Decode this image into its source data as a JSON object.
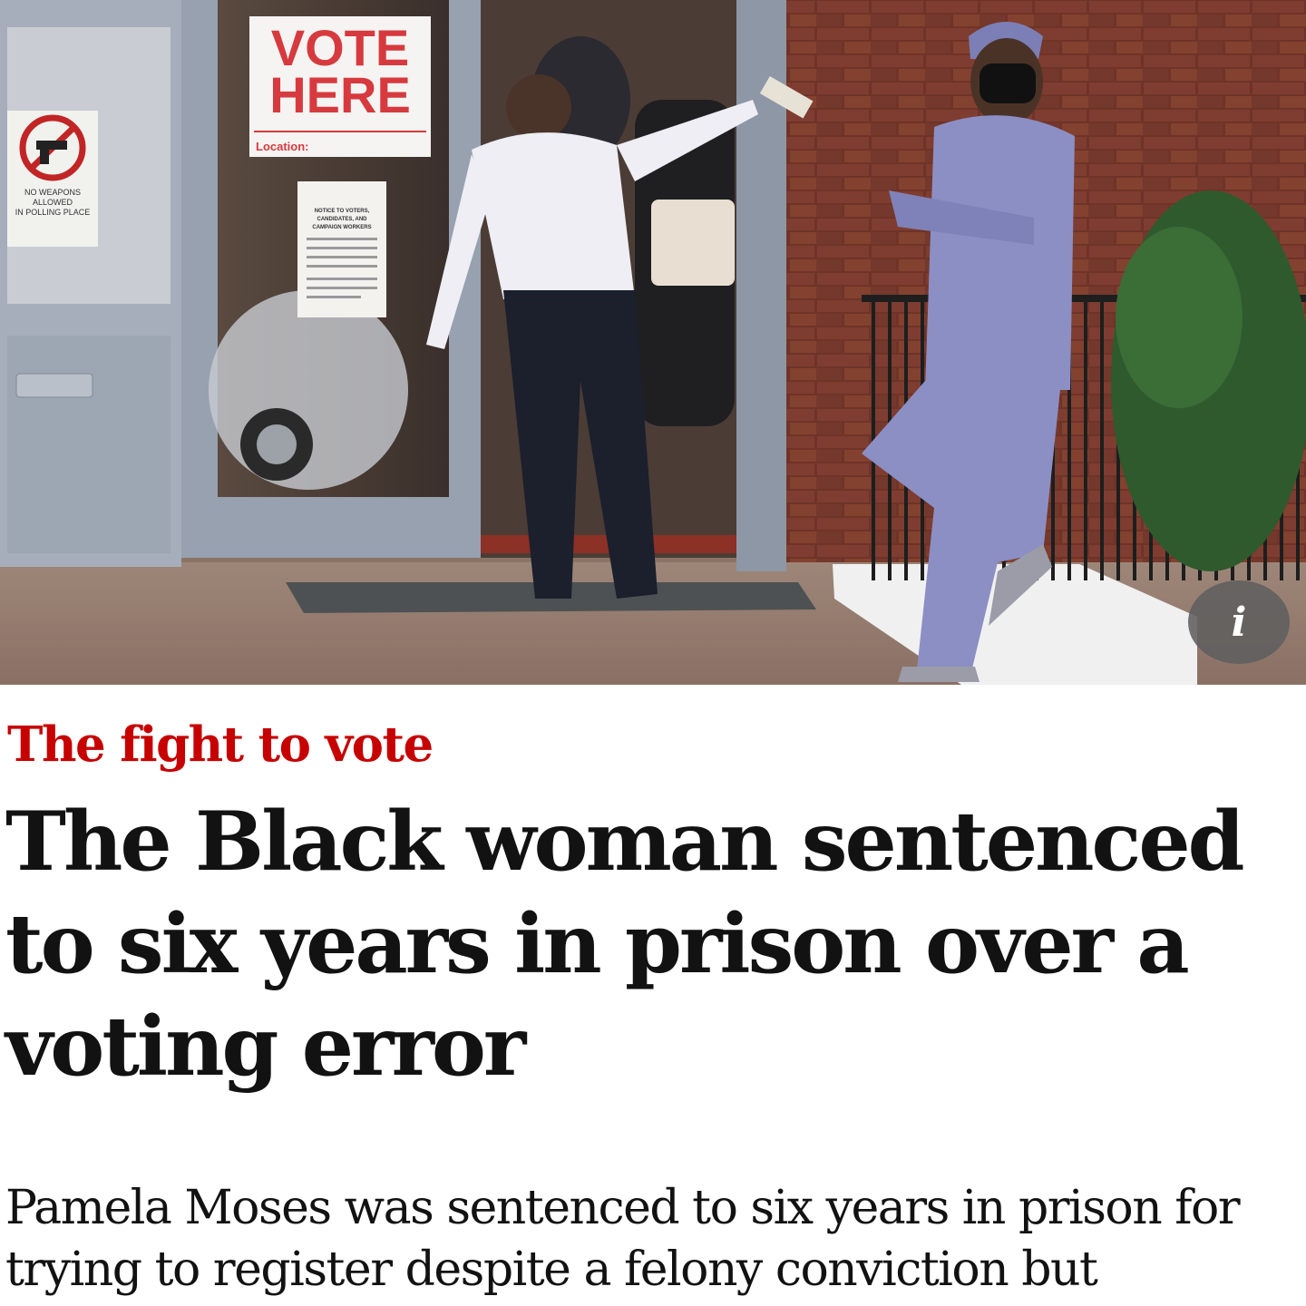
{
  "photo": {
    "vote_sign_line1": "VOTE",
    "vote_sign_line2": "HERE",
    "vote_sign_location": "Location:",
    "weapons_sign": [
      "NO WEAPONS",
      "ALLOWED",
      "IN POLLING PLACE"
    ],
    "notice_sign": [
      "NOTICE TO VOTERS,",
      "CANDIDATES, AND",
      "CAMPAIGN WORKERS"
    ],
    "info_button_label": "i",
    "colors": {
      "brick": "#7a3b2e",
      "door_frame": "#9aa4b4",
      "scrubs": "#8c8fc4"
    }
  },
  "article": {
    "kicker": "The fight to vote",
    "kicker_color": "#c70000",
    "headline": "The Black woman sentenced to six years in prison over a voting error",
    "standfirst": "Pamela Moses was sentenced to six years in prison for trying to register despite a felony conviction but"
  }
}
